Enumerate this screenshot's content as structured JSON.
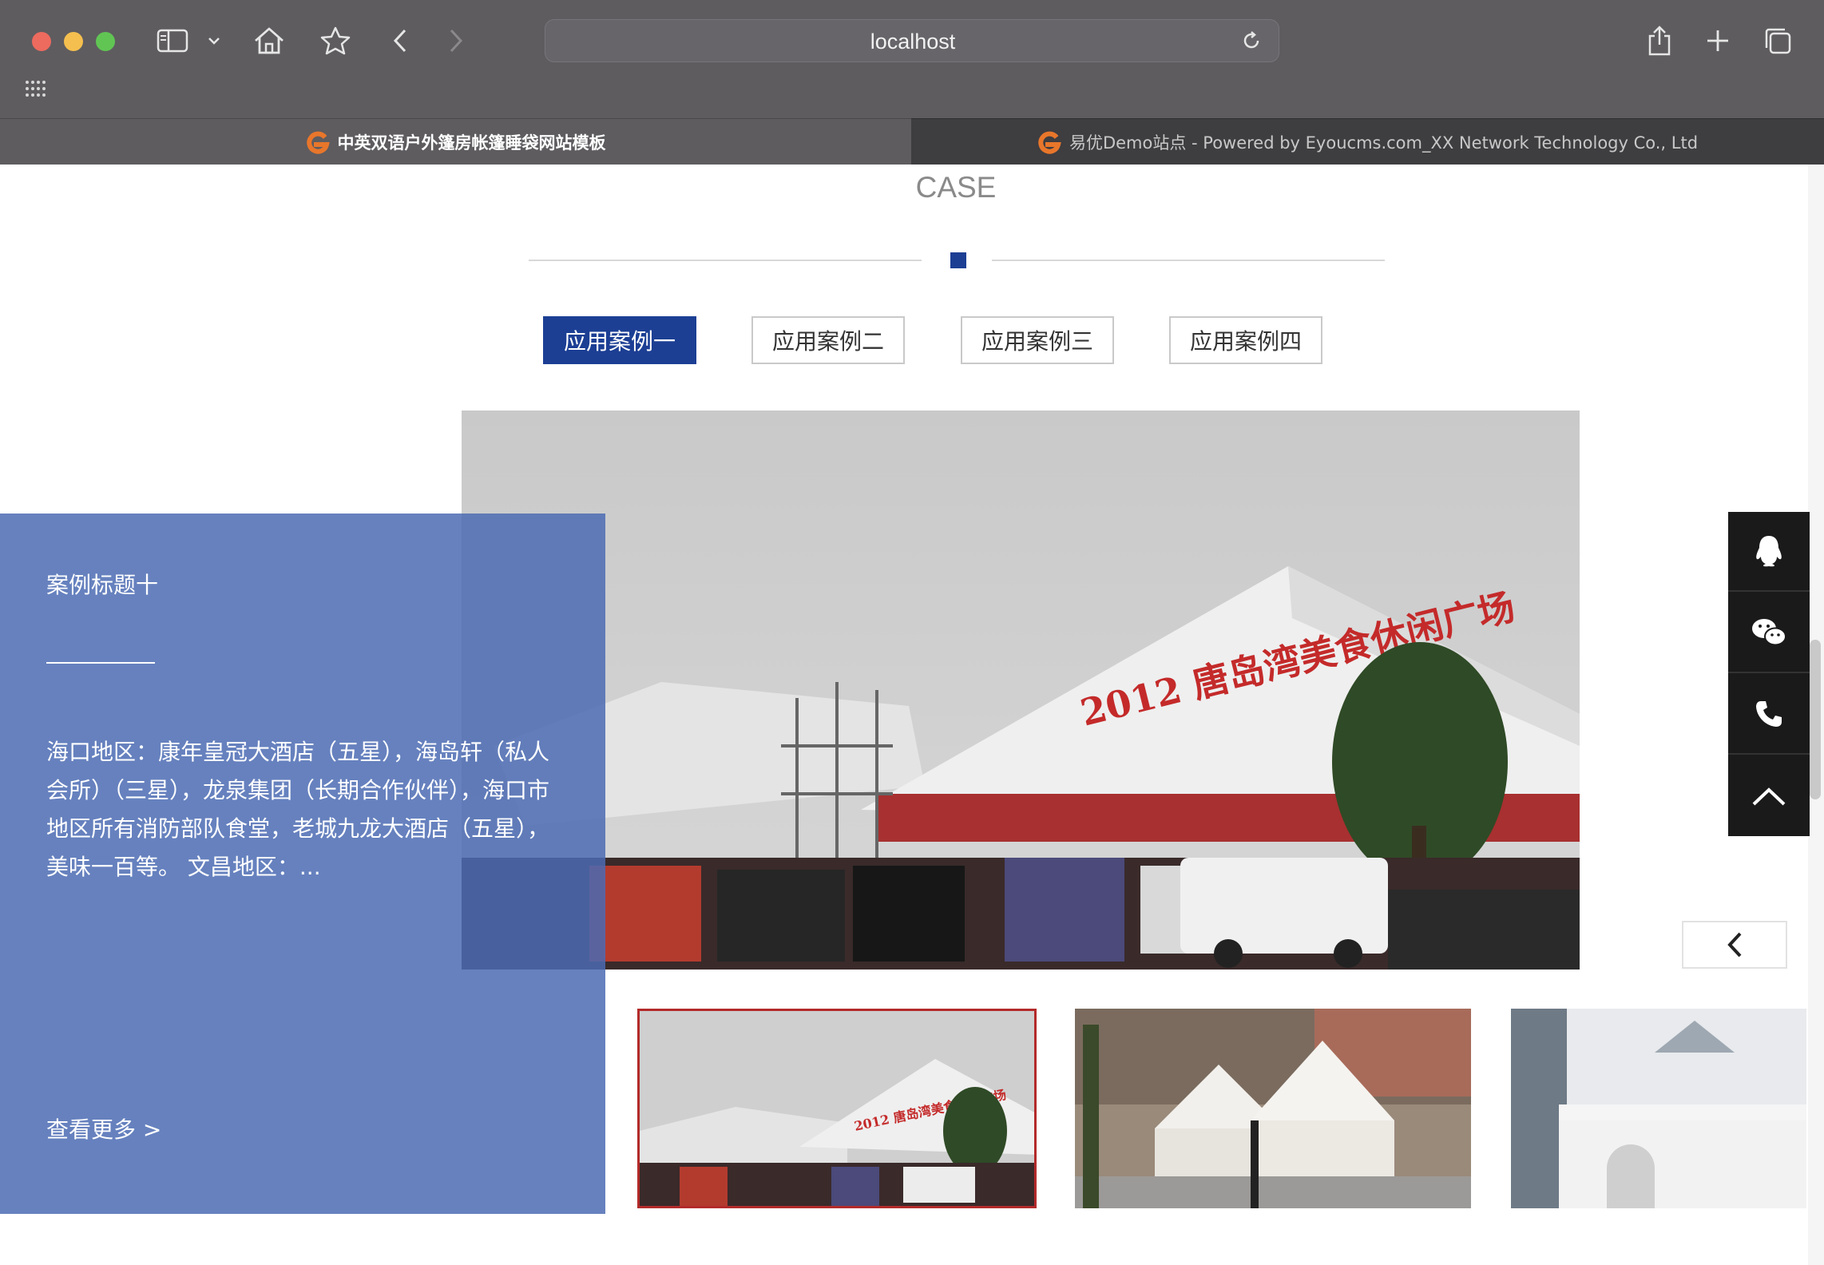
{
  "browser": {
    "address": "localhost",
    "tabs": [
      {
        "title": "中英双语户外篷房帐篷睡袋网站模板",
        "active": true
      },
      {
        "title": "易优Demo站点 - Powered by Eyoucms.com_XX Network Technology Co., Ltd",
        "active": false
      }
    ],
    "icons": {
      "sidebar": "sidebar-icon",
      "home": "home-icon",
      "bookmark": "star-icon",
      "back": "chevron-left-icon",
      "forward": "chevron-right-icon",
      "reload": "reload-icon",
      "share": "share-icon",
      "new_tab": "plus-icon",
      "tab_overview": "tabs-icon",
      "grid": "grid-icon"
    }
  },
  "section": {
    "title": "CASE",
    "accent_color": "#1c3f94",
    "tabs": [
      {
        "label": "应用案例一",
        "active": true
      },
      {
        "label": "应用案例二",
        "active": false
      },
      {
        "label": "应用案例三",
        "active": false
      },
      {
        "label": "应用案例四",
        "active": false
      }
    ]
  },
  "case": {
    "title": "案例标题十",
    "description": "海口地区：康年皇冠大酒店（五星），海岛轩（私人会所）（三星），龙泉集团（长期合作伙伴），海口市地区所有消防部队食堂，老城九龙大酒店（五星），美味一百等。 文昌地区：...",
    "more": "查看更多 >",
    "image_banner_text": "2012 唐岛湾美食休闲广场",
    "thumbnails": [
      {
        "name": "tent-festival",
        "selected": true
      },
      {
        "name": "pagoda-tents-street",
        "selected": false
      },
      {
        "name": "tent-tower",
        "selected": false
      }
    ]
  },
  "side_tools": [
    "qq-icon",
    "wechat-icon",
    "phone-icon",
    "back-to-top-icon"
  ]
}
